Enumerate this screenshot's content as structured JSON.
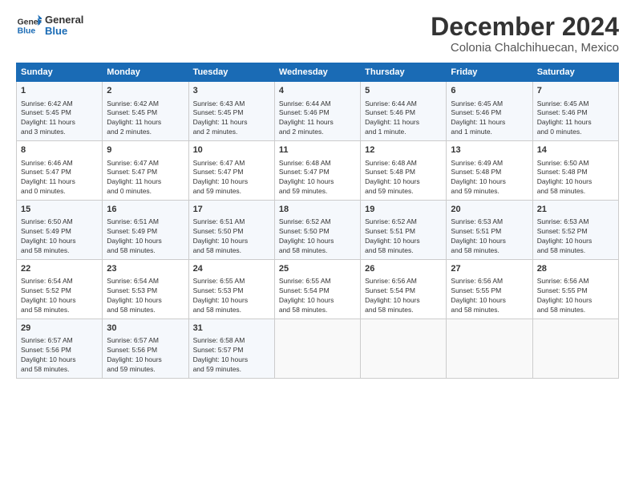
{
  "header": {
    "logo_line1": "General",
    "logo_line2": "Blue",
    "title": "December 2024",
    "subtitle": "Colonia Chalchihuecan, Mexico"
  },
  "columns": [
    "Sunday",
    "Monday",
    "Tuesday",
    "Wednesday",
    "Thursday",
    "Friday",
    "Saturday"
  ],
  "rows": [
    [
      {
        "day": "1",
        "lines": [
          "Sunrise: 6:42 AM",
          "Sunset: 5:45 PM",
          "Daylight: 11 hours",
          "and 3 minutes."
        ]
      },
      {
        "day": "2",
        "lines": [
          "Sunrise: 6:42 AM",
          "Sunset: 5:45 PM",
          "Daylight: 11 hours",
          "and 2 minutes."
        ]
      },
      {
        "day": "3",
        "lines": [
          "Sunrise: 6:43 AM",
          "Sunset: 5:45 PM",
          "Daylight: 11 hours",
          "and 2 minutes."
        ]
      },
      {
        "day": "4",
        "lines": [
          "Sunrise: 6:44 AM",
          "Sunset: 5:46 PM",
          "Daylight: 11 hours",
          "and 2 minutes."
        ]
      },
      {
        "day": "5",
        "lines": [
          "Sunrise: 6:44 AM",
          "Sunset: 5:46 PM",
          "Daylight: 11 hours",
          "and 1 minute."
        ]
      },
      {
        "day": "6",
        "lines": [
          "Sunrise: 6:45 AM",
          "Sunset: 5:46 PM",
          "Daylight: 11 hours",
          "and 1 minute."
        ]
      },
      {
        "day": "7",
        "lines": [
          "Sunrise: 6:45 AM",
          "Sunset: 5:46 PM",
          "Daylight: 11 hours",
          "and 0 minutes."
        ]
      }
    ],
    [
      {
        "day": "8",
        "lines": [
          "Sunrise: 6:46 AM",
          "Sunset: 5:47 PM",
          "Daylight: 11 hours",
          "and 0 minutes."
        ]
      },
      {
        "day": "9",
        "lines": [
          "Sunrise: 6:47 AM",
          "Sunset: 5:47 PM",
          "Daylight: 11 hours",
          "and 0 minutes."
        ]
      },
      {
        "day": "10",
        "lines": [
          "Sunrise: 6:47 AM",
          "Sunset: 5:47 PM",
          "Daylight: 10 hours",
          "and 59 minutes."
        ]
      },
      {
        "day": "11",
        "lines": [
          "Sunrise: 6:48 AM",
          "Sunset: 5:47 PM",
          "Daylight: 10 hours",
          "and 59 minutes."
        ]
      },
      {
        "day": "12",
        "lines": [
          "Sunrise: 6:48 AM",
          "Sunset: 5:48 PM",
          "Daylight: 10 hours",
          "and 59 minutes."
        ]
      },
      {
        "day": "13",
        "lines": [
          "Sunrise: 6:49 AM",
          "Sunset: 5:48 PM",
          "Daylight: 10 hours",
          "and 59 minutes."
        ]
      },
      {
        "day": "14",
        "lines": [
          "Sunrise: 6:50 AM",
          "Sunset: 5:48 PM",
          "Daylight: 10 hours",
          "and 58 minutes."
        ]
      }
    ],
    [
      {
        "day": "15",
        "lines": [
          "Sunrise: 6:50 AM",
          "Sunset: 5:49 PM",
          "Daylight: 10 hours",
          "and 58 minutes."
        ]
      },
      {
        "day": "16",
        "lines": [
          "Sunrise: 6:51 AM",
          "Sunset: 5:49 PM",
          "Daylight: 10 hours",
          "and 58 minutes."
        ]
      },
      {
        "day": "17",
        "lines": [
          "Sunrise: 6:51 AM",
          "Sunset: 5:50 PM",
          "Daylight: 10 hours",
          "and 58 minutes."
        ]
      },
      {
        "day": "18",
        "lines": [
          "Sunrise: 6:52 AM",
          "Sunset: 5:50 PM",
          "Daylight: 10 hours",
          "and 58 minutes."
        ]
      },
      {
        "day": "19",
        "lines": [
          "Sunrise: 6:52 AM",
          "Sunset: 5:51 PM",
          "Daylight: 10 hours",
          "and 58 minutes."
        ]
      },
      {
        "day": "20",
        "lines": [
          "Sunrise: 6:53 AM",
          "Sunset: 5:51 PM",
          "Daylight: 10 hours",
          "and 58 minutes."
        ]
      },
      {
        "day": "21",
        "lines": [
          "Sunrise: 6:53 AM",
          "Sunset: 5:52 PM",
          "Daylight: 10 hours",
          "and 58 minutes."
        ]
      }
    ],
    [
      {
        "day": "22",
        "lines": [
          "Sunrise: 6:54 AM",
          "Sunset: 5:52 PM",
          "Daylight: 10 hours",
          "and 58 minutes."
        ]
      },
      {
        "day": "23",
        "lines": [
          "Sunrise: 6:54 AM",
          "Sunset: 5:53 PM",
          "Daylight: 10 hours",
          "and 58 minutes."
        ]
      },
      {
        "day": "24",
        "lines": [
          "Sunrise: 6:55 AM",
          "Sunset: 5:53 PM",
          "Daylight: 10 hours",
          "and 58 minutes."
        ]
      },
      {
        "day": "25",
        "lines": [
          "Sunrise: 6:55 AM",
          "Sunset: 5:54 PM",
          "Daylight: 10 hours",
          "and 58 minutes."
        ]
      },
      {
        "day": "26",
        "lines": [
          "Sunrise: 6:56 AM",
          "Sunset: 5:54 PM",
          "Daylight: 10 hours",
          "and 58 minutes."
        ]
      },
      {
        "day": "27",
        "lines": [
          "Sunrise: 6:56 AM",
          "Sunset: 5:55 PM",
          "Daylight: 10 hours",
          "and 58 minutes."
        ]
      },
      {
        "day": "28",
        "lines": [
          "Sunrise: 6:56 AM",
          "Sunset: 5:55 PM",
          "Daylight: 10 hours",
          "and 58 minutes."
        ]
      }
    ],
    [
      {
        "day": "29",
        "lines": [
          "Sunrise: 6:57 AM",
          "Sunset: 5:56 PM",
          "Daylight: 10 hours",
          "and 58 minutes."
        ]
      },
      {
        "day": "30",
        "lines": [
          "Sunrise: 6:57 AM",
          "Sunset: 5:56 PM",
          "Daylight: 10 hours",
          "and 59 minutes."
        ]
      },
      {
        "day": "31",
        "lines": [
          "Sunrise: 6:58 AM",
          "Sunset: 5:57 PM",
          "Daylight: 10 hours",
          "and 59 minutes."
        ]
      },
      null,
      null,
      null,
      null
    ]
  ]
}
